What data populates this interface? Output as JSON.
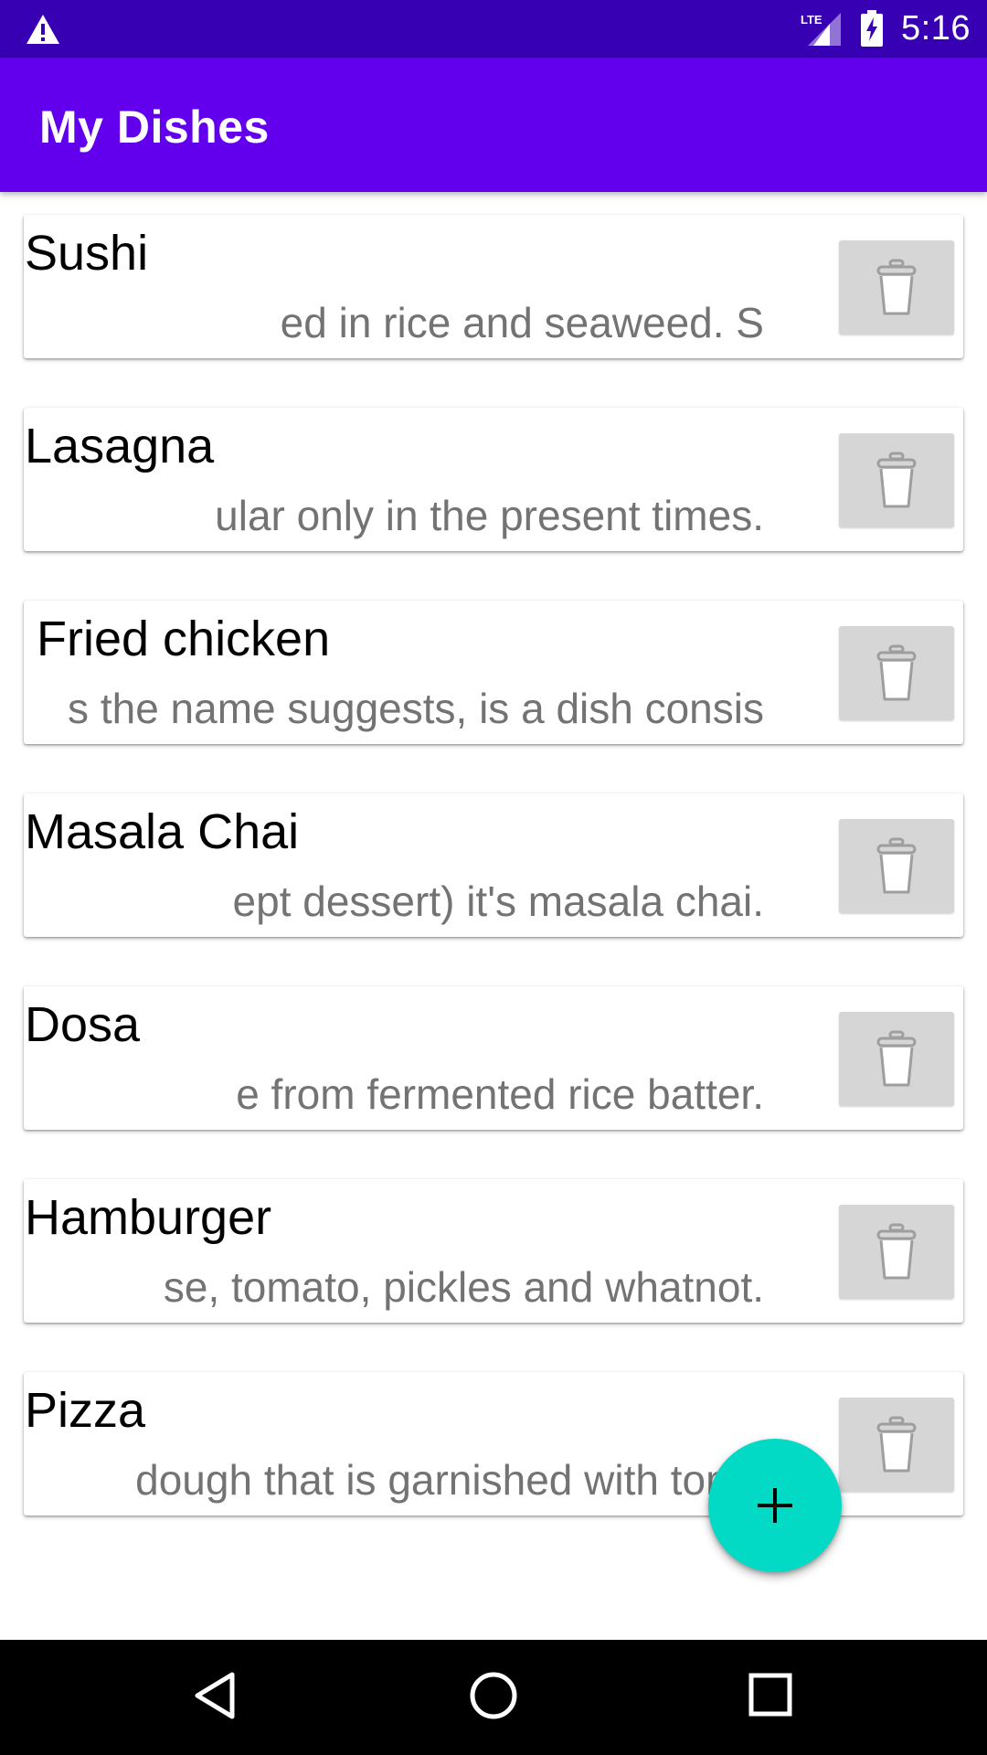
{
  "status_bar": {
    "time": "5:16",
    "network": "LTE",
    "icons": [
      "warning-icon",
      "lte-signal-icon",
      "battery-charging-icon"
    ]
  },
  "app_bar": {
    "title": "My Dishes"
  },
  "dishes": [
    {
      "name": "Sushi",
      "description_visible": "ed in rice and seaweed.             S"
    },
    {
      "name": "Lasagna",
      "description_visible": "ular only in the present times."
    },
    {
      "name": " Fried chicken",
      "description_visible": "s the name suggests, is a dish consis"
    },
    {
      "name": "Masala Chai",
      "description_visible": "ept dessert) it's masala chai."
    },
    {
      "name": "Dosa",
      "description_visible": "e from fermented rice batter."
    },
    {
      "name": "Hamburger",
      "description_visible": "se, tomato, pickles and whatnot."
    },
    {
      "name": "Pizza",
      "description_visible": "dough that is garnished with toma"
    }
  ],
  "fab": {
    "icon": "add-icon"
  },
  "nav_bar": {
    "icons": [
      "back-icon",
      "home-icon",
      "recents-icon"
    ]
  },
  "colors": {
    "status_bar": "#3700b3",
    "app_bar": "#6200ee",
    "fab": "#03dac5",
    "delete_button": "#d6d6d6",
    "description_text": "#737373"
  }
}
